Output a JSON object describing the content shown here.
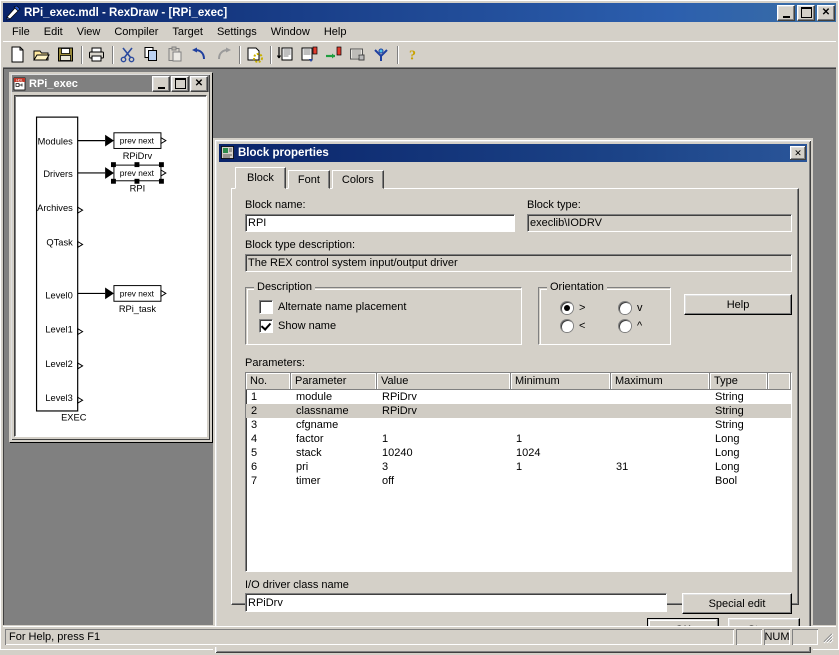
{
  "window": {
    "title": "RPi_exec.mdl - RexDraw - [RPi_exec]",
    "icon": "rexdraw-app-icon",
    "minimize": "_",
    "maximize": "□",
    "close": "✕"
  },
  "menu": {
    "items": [
      "File",
      "Edit",
      "View",
      "Compiler",
      "Target",
      "Settings",
      "Window",
      "Help"
    ]
  },
  "toolbar": {
    "buttons": [
      "new-document-icon",
      "open-folder-icon",
      "save-disk-icon",
      "print-icon",
      "cut-scissors-icon",
      "copy-icon",
      "paste-icon",
      "undo-arrow-icon",
      "redo-arrow-icon",
      "compile-icon",
      "download-icon",
      "download-target-icon",
      "connect-icon",
      "diagnostics-icon",
      "watch-icon",
      "help-question-icon"
    ]
  },
  "child_window": {
    "title": "RPi_exec",
    "icon": "hdl-document-icon",
    "minimize": "_",
    "maximize": "□",
    "close": "✕",
    "diagram": {
      "exec_block": {
        "name": "EXEC",
        "outputs": [
          "Modules",
          "Drivers",
          "Archives",
          "QTask",
          "Level0",
          "Level1",
          "Level2",
          "Level3"
        ]
      },
      "blocks": [
        {
          "name": "RPiDrv",
          "prev": "prev",
          "next": "next",
          "selected": false
        },
        {
          "name": "RPI",
          "prev": "prev",
          "next": "next",
          "selected": true
        },
        {
          "name": "RPi_task",
          "prev": "prev",
          "next": "next",
          "selected": false
        }
      ]
    }
  },
  "dialog": {
    "title": "Block properties",
    "icon": "properties-icon",
    "close": "✕",
    "tabs": [
      {
        "label": "Block",
        "active": true
      },
      {
        "label": "Font",
        "active": false
      },
      {
        "label": "Colors",
        "active": false
      }
    ],
    "block_name_label": "Block name:",
    "block_name_value": "RPI",
    "block_type_label": "Block type:",
    "block_type_value": "execlib\\IODRV",
    "block_desc_label": "Block type description:",
    "block_desc_value": "The REX control system input/output driver",
    "description_group": {
      "title": "Description",
      "checkboxes": [
        {
          "label": "Alternate name placement",
          "checked": false
        },
        {
          "label": "Show name",
          "checked": true
        }
      ]
    },
    "orientation_group": {
      "title": "Orientation",
      "options": [
        {
          "label": ">",
          "checked": true
        },
        {
          "label": "v",
          "checked": false
        },
        {
          "label": "<",
          "checked": false
        },
        {
          "label": "^",
          "checked": false
        }
      ]
    },
    "help_button": "Help",
    "parameters_label": "Parameters:",
    "parameters_columns": [
      "No.",
      "Parameter",
      "Value",
      "Minimum",
      "Maximum",
      "Type",
      ""
    ],
    "parameters_rows": [
      {
        "no": "1",
        "parameter": "module",
        "value": "RPiDrv",
        "minimum": "",
        "maximum": "",
        "type": "String",
        "selected": false
      },
      {
        "no": "2",
        "parameter": "classname",
        "value": "RPiDrv",
        "minimum": "",
        "maximum": "",
        "type": "String",
        "selected": true
      },
      {
        "no": "3",
        "parameter": "cfgname",
        "value": "",
        "minimum": "",
        "maximum": "",
        "type": "String",
        "selected": false
      },
      {
        "no": "4",
        "parameter": "factor",
        "value": "1",
        "minimum": "1",
        "maximum": "",
        "type": "Long",
        "selected": false
      },
      {
        "no": "5",
        "parameter": "stack",
        "value": "10240",
        "minimum": "1024",
        "maximum": "",
        "type": "Long",
        "selected": false
      },
      {
        "no": "6",
        "parameter": "pri",
        "value": "3",
        "minimum": "1",
        "maximum": "31",
        "type": "Long",
        "selected": false
      },
      {
        "no": "7",
        "parameter": "timer",
        "value": "off",
        "minimum": "",
        "maximum": "",
        "type": "Bool",
        "selected": false
      }
    ],
    "driver_class_label": "I/O driver class name",
    "driver_class_value": "RPiDrv",
    "special_edit_button": "Special edit",
    "ok_button": "OK",
    "cancel_button": "Storno"
  },
  "statusbar": {
    "message": "For Help, press F1",
    "pane1": "",
    "num_indicator": "NUM",
    "pane3": ""
  },
  "colors": {
    "face": "#d4d0c8",
    "title_active": "#0a246a",
    "title_inactive": "#808080",
    "mdi_client": "#808080",
    "selection": "#d0ccc4"
  }
}
